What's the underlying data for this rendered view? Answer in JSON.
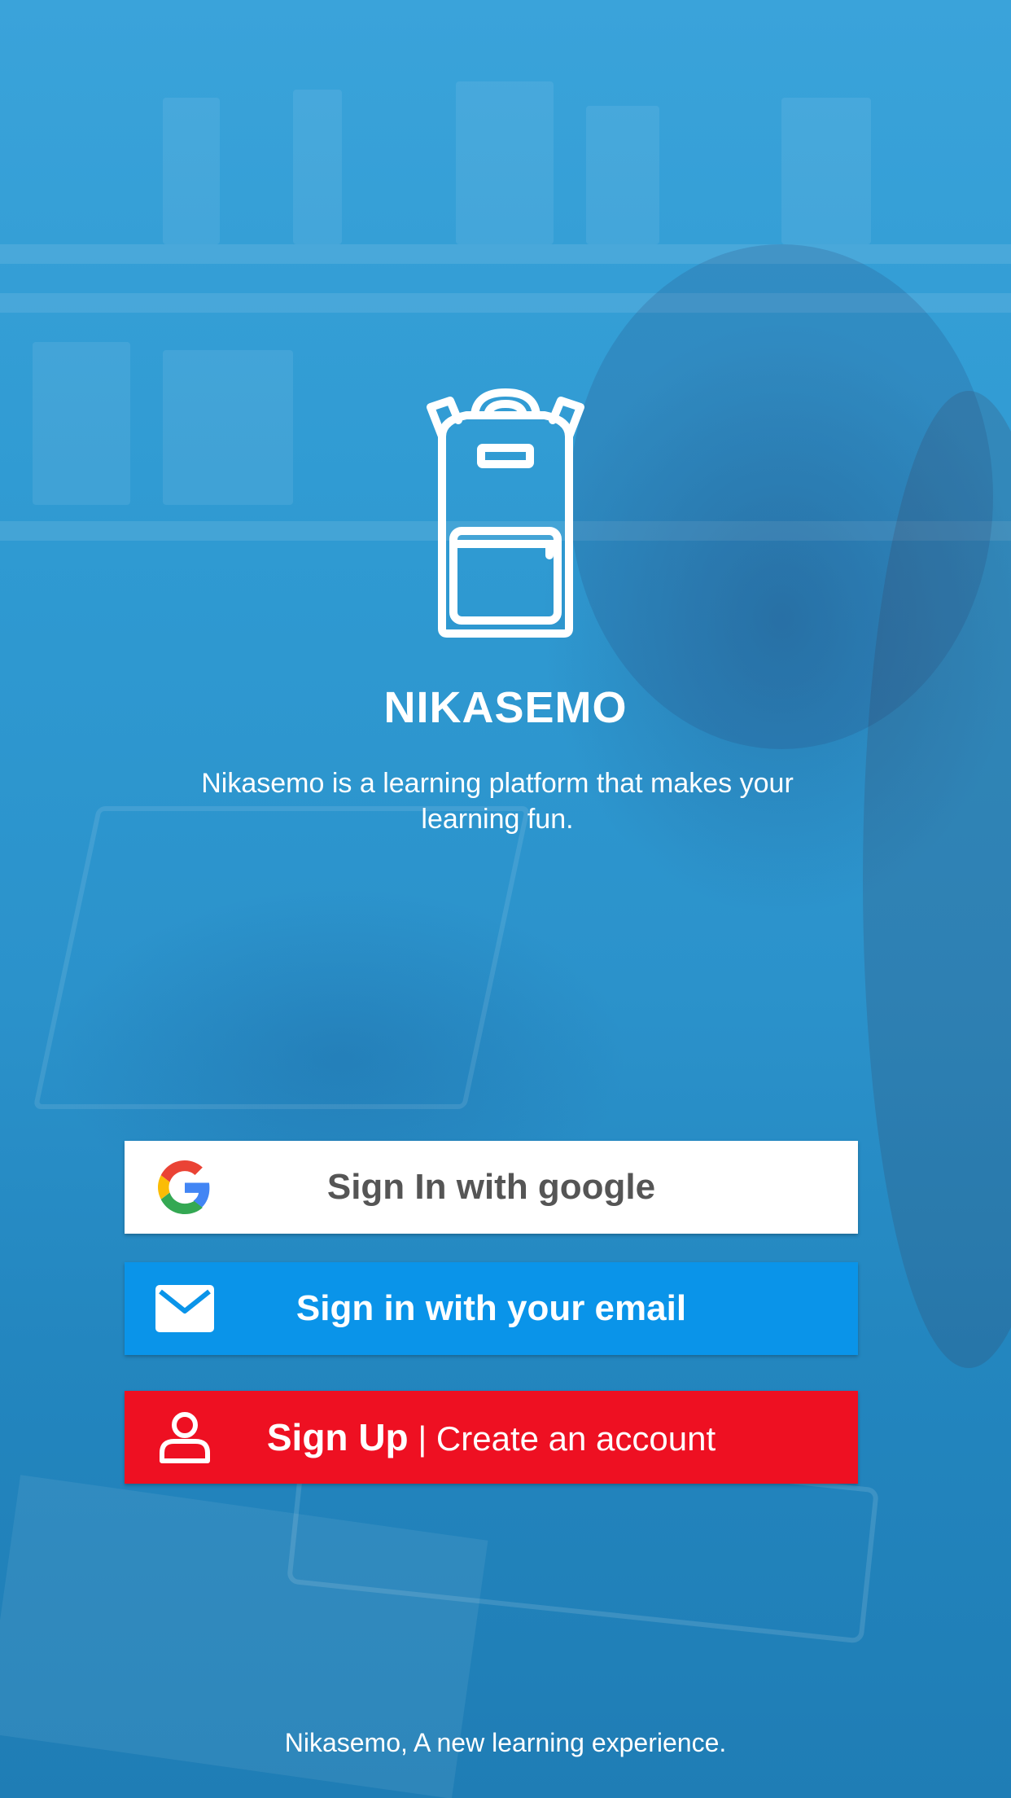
{
  "app": {
    "name": "NIKASEMO",
    "tagline": "Nikasemo is a learning platform that makes your learning fun.",
    "footer": "Nikasemo, A new learning experience."
  },
  "buttons": {
    "google": {
      "label": "Sign In with google",
      "icon": "google-logo-icon",
      "background": "#ffffff",
      "text_color": "#555555"
    },
    "email": {
      "label": "Sign in with your email",
      "icon": "envelope-icon",
      "background": "#0a94e9"
    },
    "signup": {
      "label_strong": "Sign Up",
      "separator": "|",
      "label_rest": "Create an account",
      "icon": "person-icon",
      "background": "#ee1022"
    }
  },
  "theme": {
    "overlay": "#2f9ad2"
  }
}
